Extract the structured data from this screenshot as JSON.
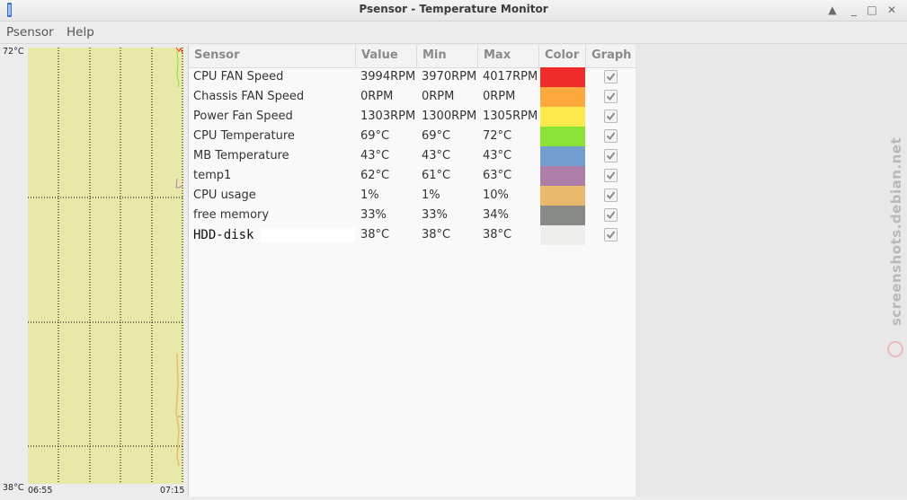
{
  "window": {
    "title": "Psensor - Temperature Monitor",
    "controls": {
      "up": "▲",
      "minimize": "_",
      "maximize": "□",
      "close": "✕"
    }
  },
  "menubar": {
    "items": [
      "Psensor",
      "Help"
    ]
  },
  "graph": {
    "y_max_label": "72°C",
    "y_min_label": "38°C",
    "x_start_label": "06:55",
    "x_end_label": "07:15",
    "background_color": "#e8e8a8"
  },
  "table": {
    "headers": {
      "sensor": "Sensor",
      "value": "Value",
      "min": "Min",
      "max": "Max",
      "color": "Color",
      "graph": "Graph"
    },
    "rows": [
      {
        "sensor": "CPU FAN Speed",
        "value": "3994RPM",
        "min": "3970RPM",
        "max": "4017RPM",
        "color": "#ef2b2b",
        "graph": true
      },
      {
        "sensor": "Chassis FAN Speed",
        "value": "0RPM",
        "min": "0RPM",
        "max": "0RPM",
        "color": "#fca83c",
        "graph": true
      },
      {
        "sensor": "Power Fan Speed",
        "value": "1303RPM",
        "min": "1300RPM",
        "max": "1305RPM",
        "color": "#fbe84a",
        "graph": true
      },
      {
        "sensor": "CPU Temperature",
        "value": "69°C",
        "min": "69°C",
        "max": "72°C",
        "color": "#8ae234",
        "graph": true
      },
      {
        "sensor": "MB Temperature",
        "value": "43°C",
        "min": "43°C",
        "max": "43°C",
        "color": "#729fcf",
        "graph": true
      },
      {
        "sensor": "temp1",
        "value": "62°C",
        "min": "61°C",
        "max": "63°C",
        "color": "#ad7fa8",
        "graph": true
      },
      {
        "sensor": "CPU usage",
        "value": "1%",
        "min": "1%",
        "max": "10%",
        "color": "#e9b96e",
        "graph": true
      },
      {
        "sensor": "free memory",
        "value": "33%",
        "min": "33%",
        "max": "34%",
        "color": "#888a85",
        "graph": true
      },
      {
        "sensor": "HDD-disk",
        "value": "38°C",
        "min": "38°C",
        "max": "38°C",
        "color": "#eeeeec",
        "graph": true
      }
    ]
  },
  "watermark": {
    "text": "screenshots.debian.net"
  }
}
